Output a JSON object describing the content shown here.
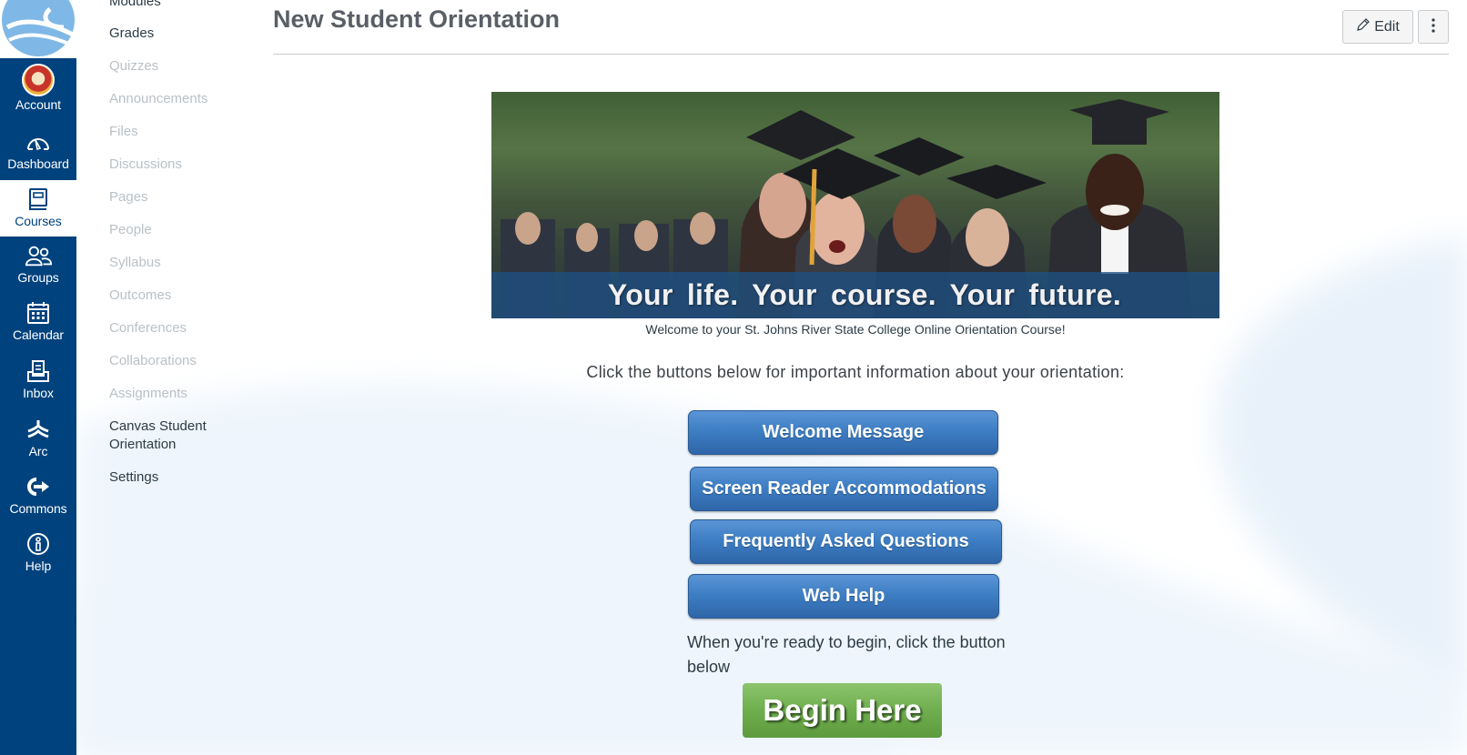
{
  "global_nav": {
    "items": [
      {
        "label": "Account",
        "icon": "avatar"
      },
      {
        "label": "Dashboard",
        "icon": "dashboard-gauge-icon"
      },
      {
        "label": "Courses",
        "icon": "book-icon",
        "active": true
      },
      {
        "label": "Groups",
        "icon": "groups-icon"
      },
      {
        "label": "Calendar",
        "icon": "calendar-icon"
      },
      {
        "label": "Inbox",
        "icon": "inbox-icon"
      },
      {
        "label": "Arc",
        "icon": "arc-icon"
      },
      {
        "label": "Commons",
        "icon": "commons-icon"
      },
      {
        "label": "Help",
        "icon": "help-icon"
      }
    ]
  },
  "course_nav": {
    "items": [
      {
        "label": "Modules",
        "enabled": true
      },
      {
        "label": "Grades",
        "enabled": true
      },
      {
        "label": "Quizzes",
        "enabled": false
      },
      {
        "label": "Announcements",
        "enabled": false
      },
      {
        "label": "Files",
        "enabled": false
      },
      {
        "label": "Discussions",
        "enabled": false
      },
      {
        "label": "Pages",
        "enabled": false
      },
      {
        "label": "People",
        "enabled": false
      },
      {
        "label": "Syllabus",
        "enabled": false
      },
      {
        "label": "Outcomes",
        "enabled": false
      },
      {
        "label": "Conferences",
        "enabled": false
      },
      {
        "label": "Collaborations",
        "enabled": false
      },
      {
        "label": "Assignments",
        "enabled": false
      },
      {
        "label": "Canvas Student Orientation",
        "enabled": true
      },
      {
        "label": "Settings",
        "enabled": true
      }
    ]
  },
  "header": {
    "title": "New Student Orientation",
    "edit_label": "Edit"
  },
  "content": {
    "banner_tagline": "Your life.  Your course.  Your future.",
    "welcome_caption": "Welcome to your St. Johns River State College Online Orientation Course!",
    "instructions": "Click the buttons below for important information about your orientation:",
    "buttons": [
      {
        "label": "Welcome Message"
      },
      {
        "label": "Screen Reader Accommodations"
      },
      {
        "label": "Frequently Asked Questions"
      },
      {
        "label": "Web Help"
      }
    ],
    "ready_text": "When you're ready to begin, click the button below",
    "begin_label": "Begin Here"
  },
  "colors": {
    "nav_bg": "#00427d",
    "info_button": "#3e7ec4",
    "begin_button": "#6fae4e"
  }
}
